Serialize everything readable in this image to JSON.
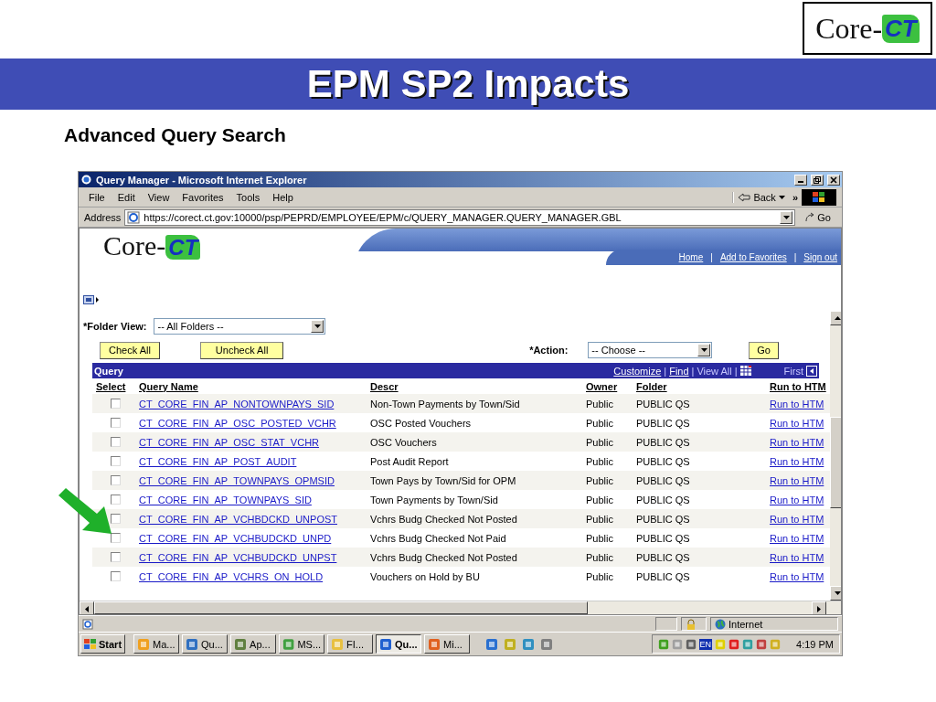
{
  "slide_logo": {
    "prefix": "Core-",
    "mark": "CT"
  },
  "slide_title": "EPM SP2 Impacts",
  "slide_subtitle": "Advanced Query Search",
  "browser": {
    "title": "Query Manager - Microsoft Internet Explorer",
    "menu": [
      "File",
      "Edit",
      "View",
      "Favorites",
      "Tools",
      "Help"
    ],
    "back_label": "Back",
    "chevron": "»",
    "address_label": "Address",
    "url": "https://corect.ct.gov:10000/psp/PEPRD/EMPLOYEE/EPM/c/QUERY_MANAGER.QUERY_MANAGER.GBL",
    "go_label": "Go",
    "status_zone": "Internet"
  },
  "page": {
    "logo": {
      "prefix": "Core-",
      "mark": "CT"
    },
    "header_links": [
      "Home",
      "Add to Favorites",
      "Sign out"
    ],
    "separator": "|",
    "folder_view": {
      "label": "*Folder View:",
      "value": "-- All Folders --"
    },
    "buttons": [
      "Check All",
      "Uncheck All"
    ],
    "action": {
      "label": "*Action:",
      "value": "-- Choose --",
      "button": "Go"
    },
    "grid_title": "Query",
    "grid_nav": {
      "customize": "Customize",
      "find": "Find",
      "view_all": "View All",
      "first": "First"
    },
    "columns": [
      "Select",
      "Query Name",
      "Descr",
      "Owner",
      "Folder",
      "Run to HTM"
    ],
    "rows": [
      {
        "checked": false,
        "name": "CT_CORE_FIN_AP_NONTOWNPAYS_SID",
        "descr": "Non-Town Payments by Town/Sid",
        "owner": "Public",
        "folder": "PUBLIC QS",
        "run": "Run to HTM"
      },
      {
        "checked": false,
        "name": "CT_CORE_FIN_AP_OSC_POSTED_VCHR",
        "descr": "OSC Posted Vouchers",
        "owner": "Public",
        "folder": "PUBLIC QS",
        "run": "Run to HTM"
      },
      {
        "checked": false,
        "name": "CT_CORE_FIN_AP_OSC_STAT_VCHR",
        "descr": "OSC Vouchers",
        "owner": "Public",
        "folder": "PUBLIC QS",
        "run": "Run to HTM"
      },
      {
        "checked": false,
        "name": "CT_CORE_FIN_AP_POST_AUDIT",
        "descr": "Post Audit Report",
        "owner": "Public",
        "folder": "PUBLIC QS",
        "run": "Run to HTM"
      },
      {
        "checked": false,
        "name": "CT_CORE_FIN_AP_TOWNPAYS_OPMSID",
        "descr": "Town Pays by Town/Sid for OPM",
        "owner": "Public",
        "folder": "PUBLIC QS",
        "run": "Run to HTM"
      },
      {
        "checked": false,
        "name": "CT_CORE_FIN_AP_TOWNPAYS_SID",
        "descr": "Town Payments by Town/Sid",
        "owner": "Public",
        "folder": "PUBLIC QS",
        "run": "Run to HTM"
      },
      {
        "checked": false,
        "name": "CT_CORE_FIN_AP_VCHBDCKD_UNPOST",
        "descr": "Vchrs Budg Checked Not Posted",
        "owner": "Public",
        "folder": "PUBLIC QS",
        "run": "Run to HTM"
      },
      {
        "checked": false,
        "name": "CT_CORE_FIN_AP_VCHBUDCKD_UNPD",
        "descr": "Vchrs Budg Checked Not Paid",
        "owner": "Public",
        "folder": "PUBLIC QS",
        "run": "Run to HTM"
      },
      {
        "checked": false,
        "name": "CT_CORE_FIN_AP_VCHBUDCKD_UNPST",
        "descr": "Vchrs Budg Checked Not Posted",
        "owner": "Public",
        "folder": "PUBLIC QS",
        "run": "Run to HTM"
      },
      {
        "checked": false,
        "name": "CT_CORE_FIN_AP_VCHRS_ON_HOLD",
        "descr": "Vouchers on Hold by BU",
        "owner": "Public",
        "folder": "PUBLIC QS",
        "run": "Run to HTM"
      }
    ]
  },
  "taskbar": {
    "start": "Start",
    "items": [
      {
        "label": "Ma...",
        "color": "#f0a020",
        "selected": false
      },
      {
        "label": "Qu...",
        "color": "#3070c0",
        "selected": false
      },
      {
        "label": "Ap...",
        "color": "#608040",
        "selected": false
      },
      {
        "label": "MS...",
        "color": "#40a040",
        "selected": false
      },
      {
        "label": "FI...",
        "color": "#e8c040",
        "selected": false
      },
      {
        "label": "Qu...",
        "color": "#2060d0",
        "selected": true
      },
      {
        "label": "Mi...",
        "color": "#e06020",
        "selected": false
      }
    ],
    "language": "EN",
    "clock": "4:19 PM"
  }
}
